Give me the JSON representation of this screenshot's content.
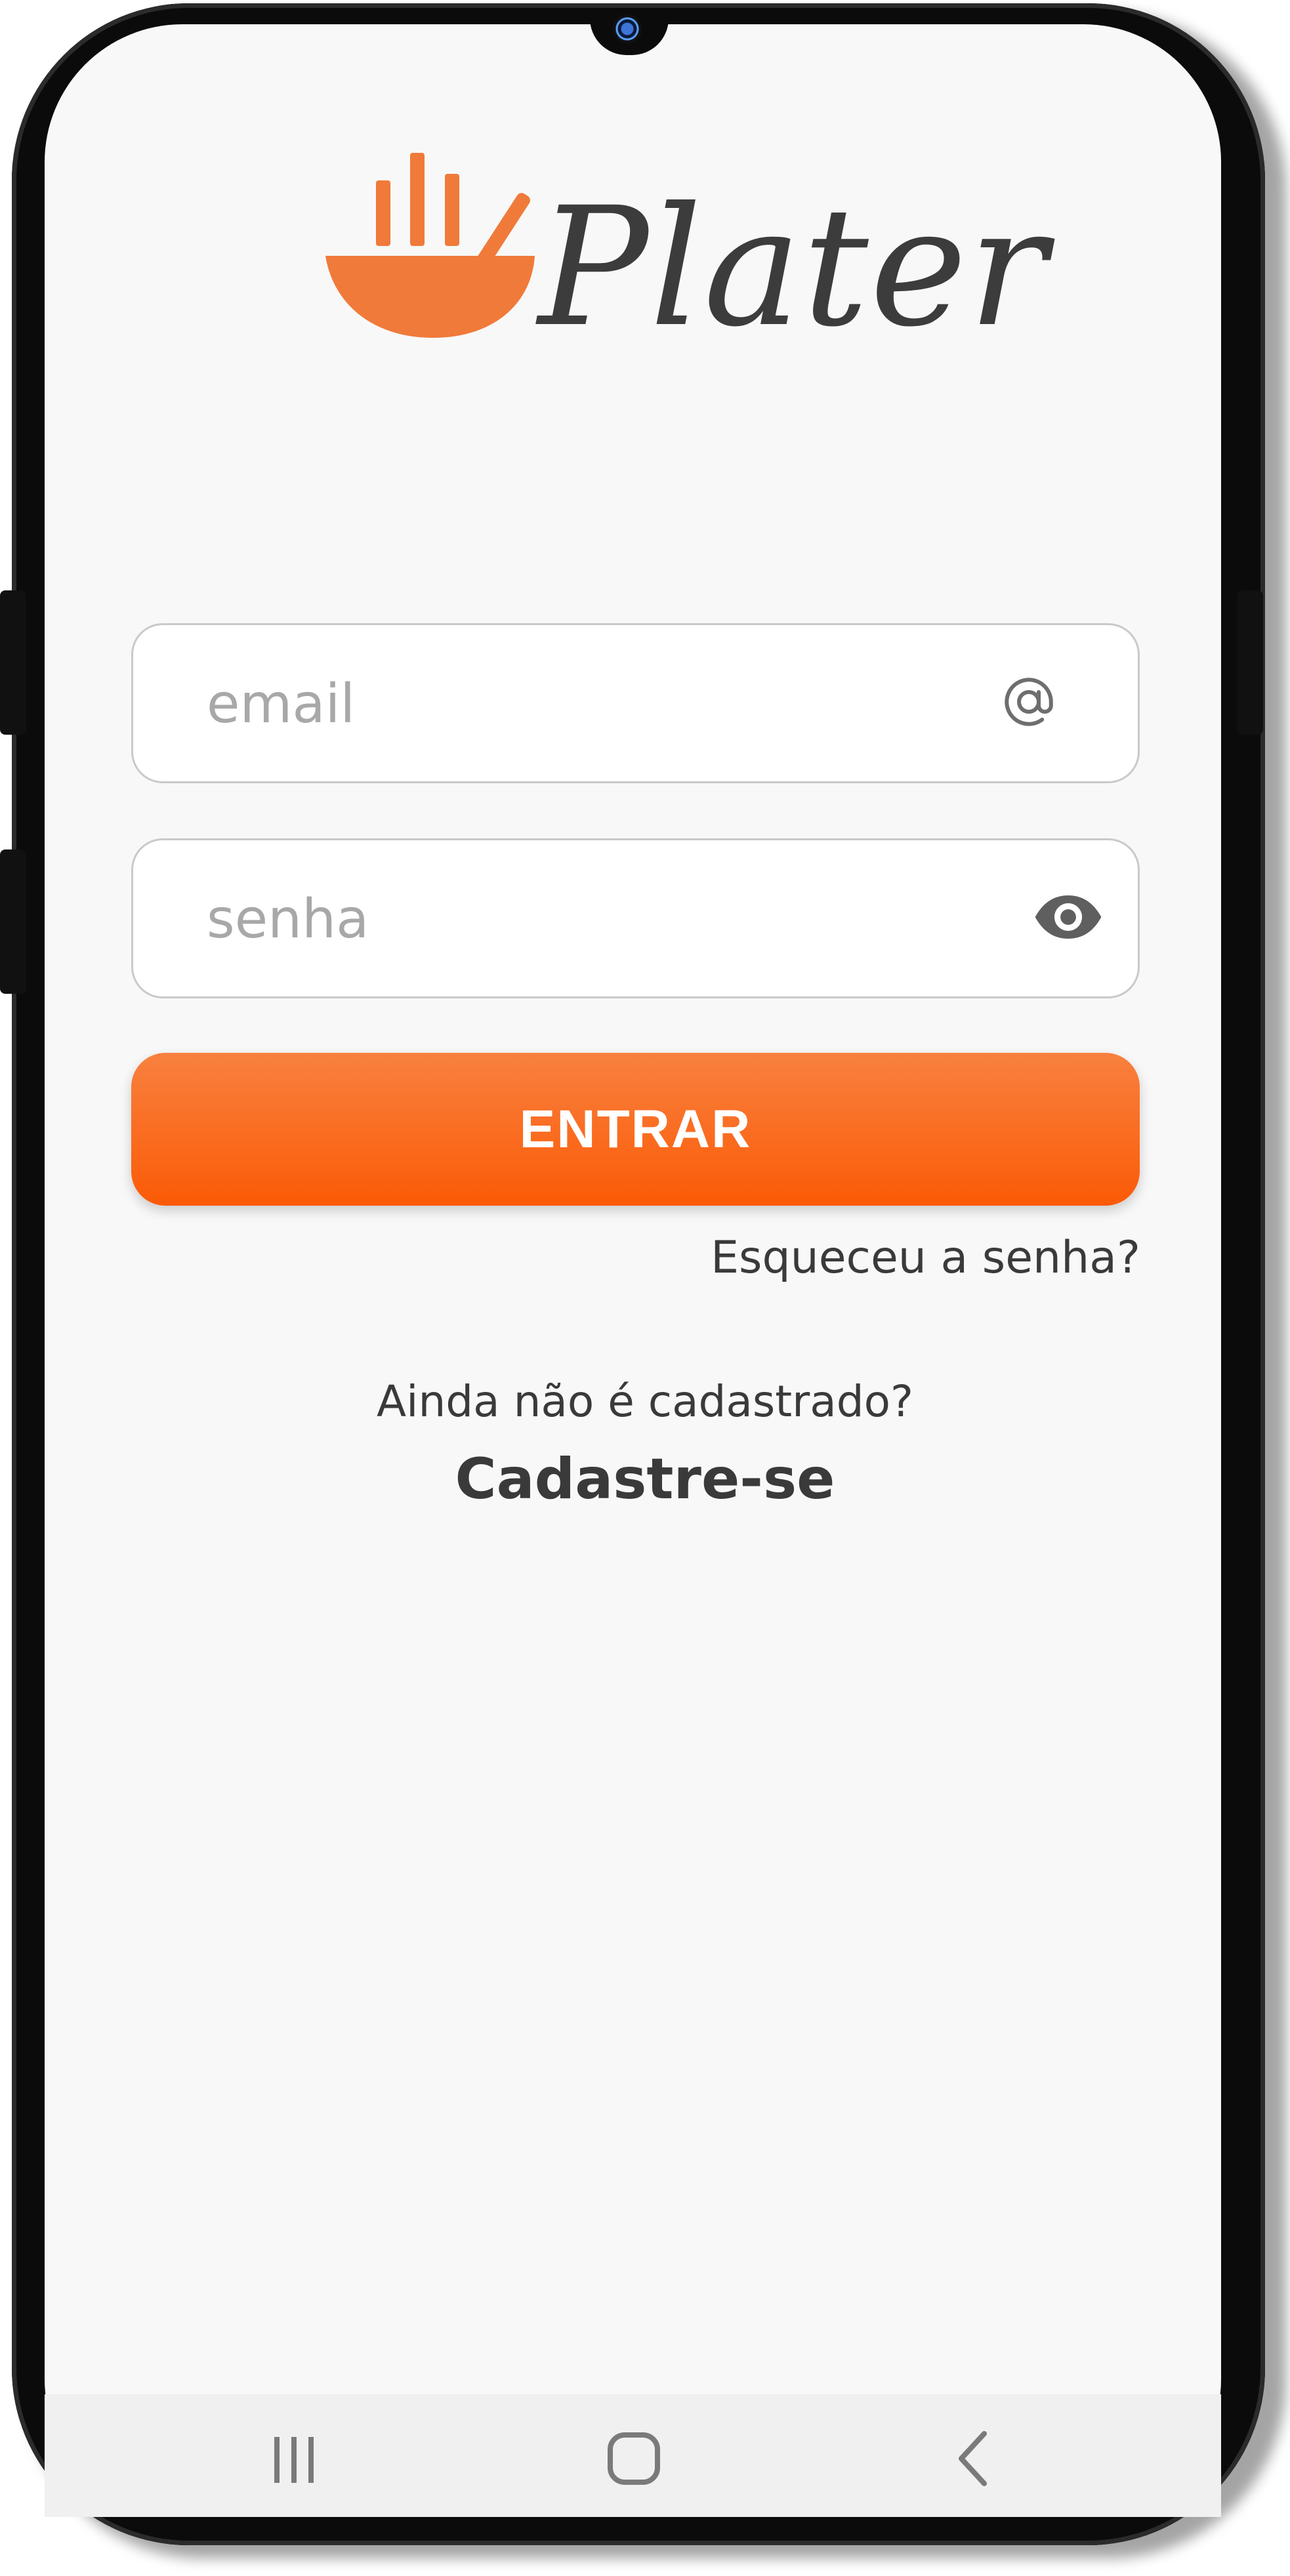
{
  "app": {
    "name": "Plater",
    "brand_color": "#F26A21",
    "text_color": "#3C3C3C"
  },
  "login": {
    "email_placeholder": "email",
    "email_icon": "at-icon",
    "password_placeholder": "senha",
    "password_icon": "eye-icon",
    "submit_label": "ENTRAR",
    "forgot_label": "Esqueceu a senha?",
    "signup_prompt": "Ainda não é cadastrado?",
    "signup_label": "Cadastre-se"
  },
  "navbar": {
    "recents_icon": "recent-apps-icon",
    "home_icon": "home-icon",
    "back_icon": "back-icon"
  }
}
